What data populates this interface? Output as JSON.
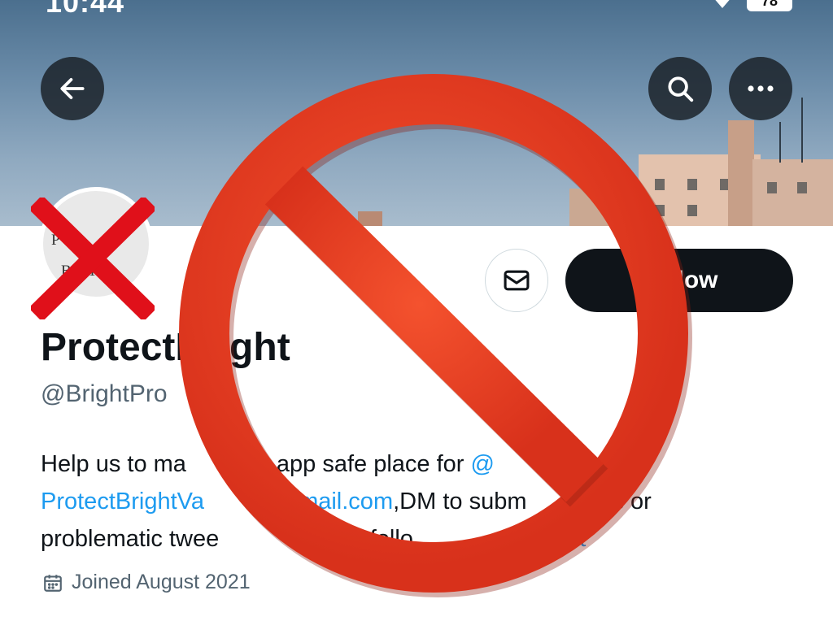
{
  "status_bar": {
    "time": "10:44",
    "battery": "78"
  },
  "profile": {
    "name": "ProtectBright",
    "handle": "@BrightPro",
    "avatar_text_line1": "P      T",
    "avatar_text_line2": "B     IT",
    "bio_line1_text": "Help us to ma",
    "bio_line1_text_b": "is app safe place for ",
    "bio_line1_link": "@",
    "bio_line2_link_a": "ProtectBrightVa",
    "bio_line2_link_b": "gmail.com",
    "bio_line2_text": ",DM to subm",
    "bio_line2_text_b": "s or",
    "bio_line3_text": "problematic twee",
    "bio_line3_text_b": "ck and follo",
    "bio_line3_link": "ectBright",
    "joined": "Joined August 2021"
  },
  "buttons": {
    "follow_label": "Follow"
  },
  "icons": {
    "back": "arrow-left-icon",
    "search": "search-icon",
    "more": "more-horizontal-icon",
    "message": "envelope-icon",
    "calendar": "calendar-icon"
  },
  "colors": {
    "link": "#1d9bf0",
    "follow_bg": "#0f1419",
    "ban_red": "#e63a1e",
    "x_red": "#e0101a"
  }
}
